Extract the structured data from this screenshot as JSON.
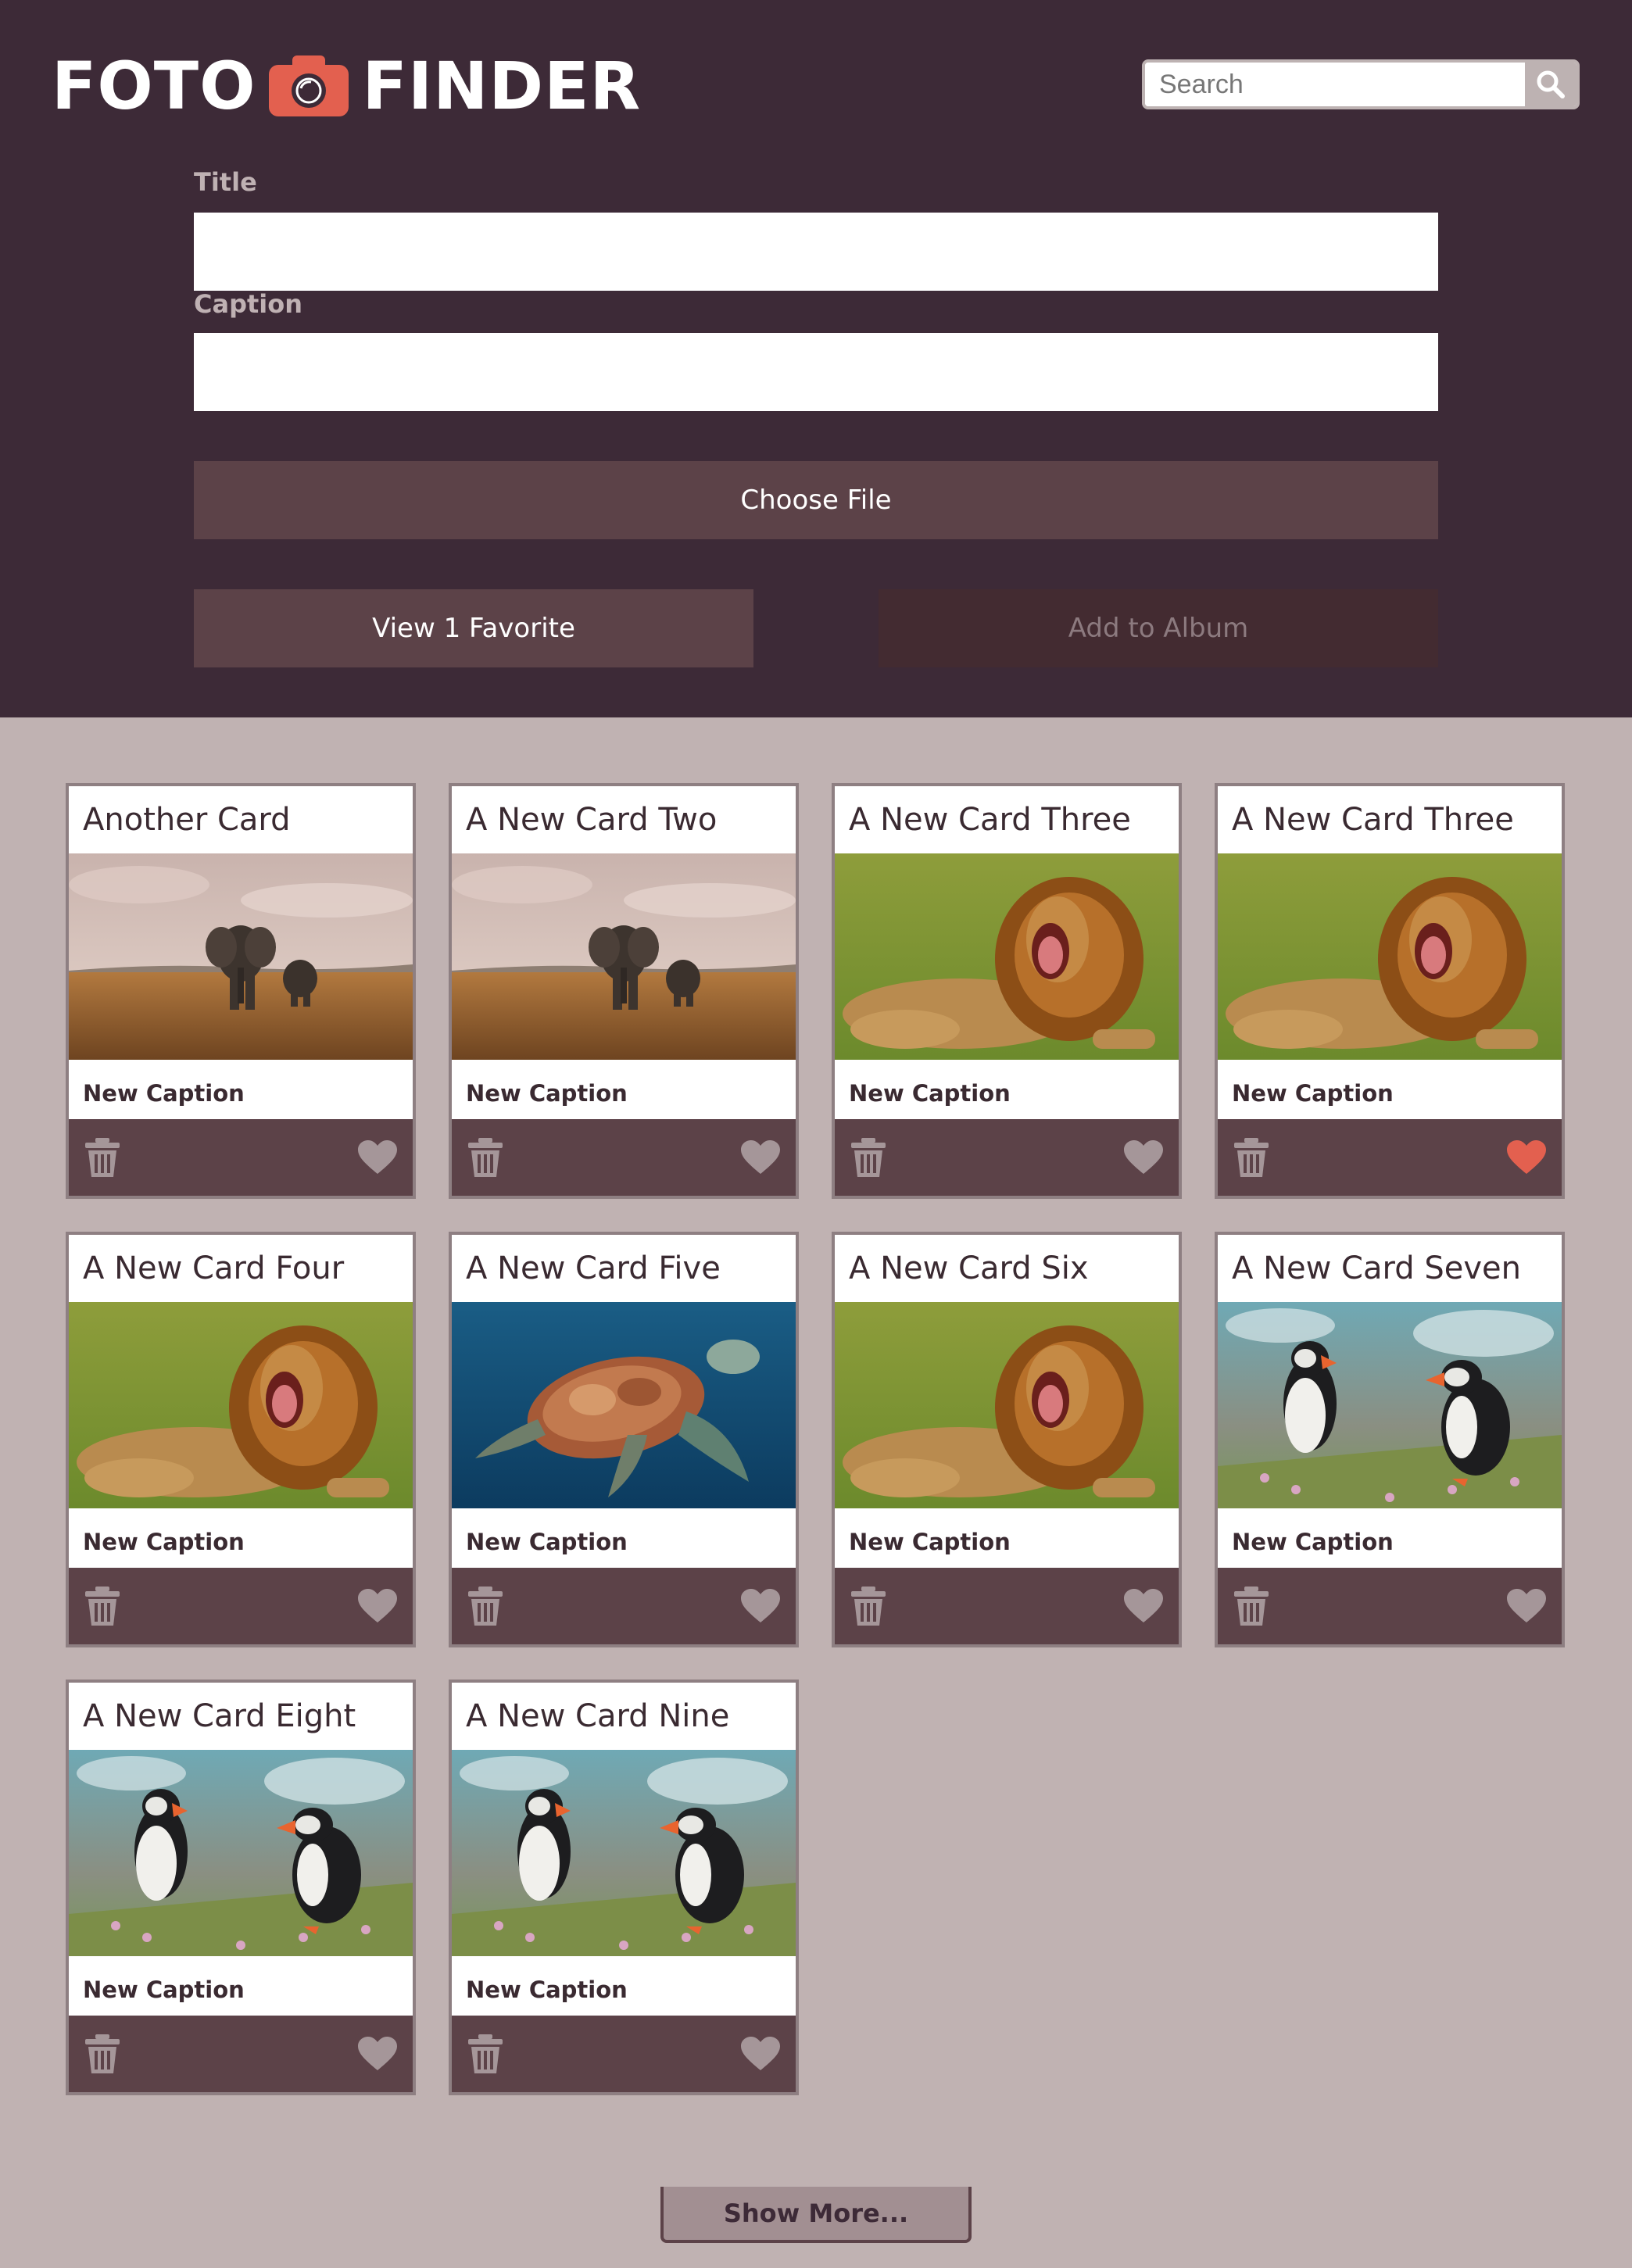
{
  "app": {
    "logo_left": "FOTO",
    "logo_right": "FINDER",
    "logo_icon": "camera-icon"
  },
  "search": {
    "placeholder": "Search",
    "icon": "search-icon"
  },
  "form": {
    "title_label": "Title",
    "title_value": "",
    "caption_label": "Caption",
    "caption_value": "",
    "choose_file_label": "Choose File",
    "view_favorites_label": "View 1 Favorite",
    "add_album_label": "Add to Album"
  },
  "cards": [
    {
      "title": "Another Card",
      "caption": "New Caption",
      "image": "elephants",
      "favorite": false
    },
    {
      "title": "A New Card Two",
      "caption": "New Caption",
      "image": "elephants",
      "favorite": false
    },
    {
      "title": "A New Card Three",
      "caption": "New Caption",
      "image": "lion",
      "favorite": false
    },
    {
      "title": "A New Card Three",
      "caption": "New Caption",
      "image": "lion",
      "favorite": true
    },
    {
      "title": "A New Card Four",
      "caption": "New Caption",
      "image": "lion",
      "favorite": false
    },
    {
      "title": "A New Card Five",
      "caption": "New Caption",
      "image": "turtle",
      "favorite": false
    },
    {
      "title": "A New Card Six",
      "caption": "New Caption",
      "image": "lion",
      "favorite": false
    },
    {
      "title": "A New Card Seven",
      "caption": "New Caption",
      "image": "puffins",
      "favorite": false
    },
    {
      "title": "A New Card Eight",
      "caption": "New Caption",
      "image": "puffins",
      "favorite": false
    },
    {
      "title": "A New Card Nine",
      "caption": "New Caption",
      "image": "puffins",
      "favorite": false
    }
  ],
  "show_more_label": "Show More...",
  "colors": {
    "header_bg": "#3d2a37",
    "page_bg": "#c0b2b2",
    "button_bg": "#5c4248",
    "favorite_active": "#e3604f",
    "favorite_inactive": "#a59699",
    "camera_accent": "#e3604f"
  }
}
